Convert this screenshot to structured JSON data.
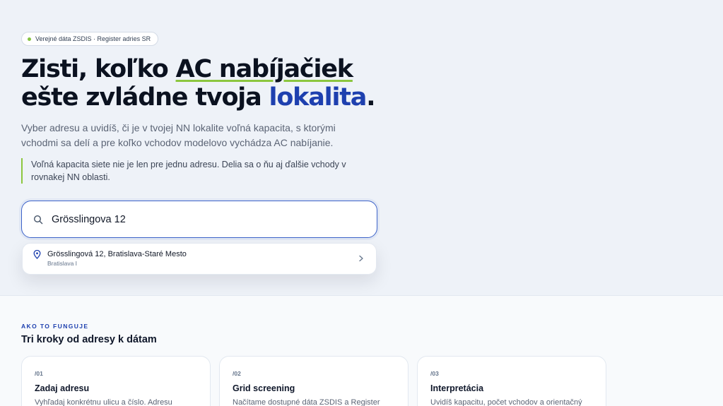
{
  "badge": {
    "text": "Verejné dáta ZSDIS · Register adries SR"
  },
  "headline": {
    "part1": "Zisti, koľko ",
    "underlined": "AC nabíjačiek",
    "part2": "ešte zvládne tvoja ",
    "highlight": "lokalita",
    "end": "."
  },
  "lead": "Vyber adresu a uvidíš, či je v tvojej NN lokalite voľná kapacita, s ktorými vchodmi sa delí a pre koľko vchodov modelovo vychádza AC nabíjanie.",
  "note": "Voľná kapacita siete nie je len pre jednu adresu. Delia sa o ňu aj ďalšie vchody v rovnakej NN oblasti.",
  "search": {
    "value": "Grösslingova 12"
  },
  "suggestion": {
    "title": "Grösslingová 12, Bratislava-Staré Mesto",
    "subtitle": "Bratislava I"
  },
  "how": {
    "eyebrow": "AKO TO FUNGUJE",
    "title": "Tri kroky od adresy k dátam",
    "steps": [
      {
        "num": "/01",
        "title": "Zadaj adresu",
        "text": "Vyhľadaj konkrétnu ulicu a číslo. Adresu"
      },
      {
        "num": "/02",
        "title": "Grid screening",
        "text": "Načítame dostupné dáta ZSDIS a Register"
      },
      {
        "num": "/03",
        "title": "Interpretácia",
        "text": "Uvidíš kapacitu, počet vchodov a orientačný"
      }
    ]
  },
  "colors": {
    "accent_blue": "#1e40af",
    "accent_green": "#8cc63f",
    "background": "#eef2f8"
  },
  "icons": {
    "search": "search-icon",
    "pin": "map-pin-icon",
    "chevron": "chevron-right-icon",
    "status_dot": "status-dot-icon"
  }
}
